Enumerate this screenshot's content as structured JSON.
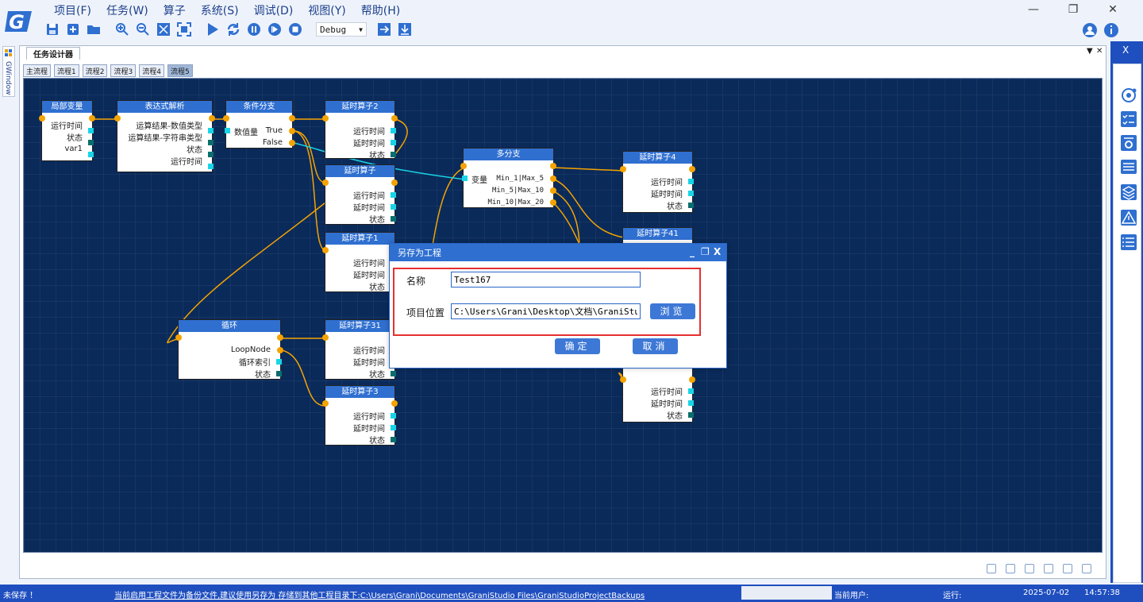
{
  "app": {
    "logo_letter": "G"
  },
  "menu": [
    "项目(F)",
    "任务(W)",
    "算子",
    "系统(S)",
    "调试(D)",
    "视图(Y)",
    "帮助(H)"
  ],
  "toolbar": {
    "mode_value": "Debug",
    "mode_arrow": "▼"
  },
  "window_controls": {
    "minimize": "—",
    "restore": "❐",
    "close": "✕"
  },
  "gwindow": {
    "label": "GWindow"
  },
  "designer": {
    "tab": "任务设计器",
    "controls": {
      "dropdown": "▼",
      "close": "✕"
    },
    "flow_tabs": [
      "主流程",
      "流程1",
      "流程2",
      "流程3",
      "流程4",
      "流程5"
    ],
    "active_flow_tab": 5
  },
  "nodes": {
    "local_var": {
      "title": "局部变量",
      "ports": [
        "运行时间",
        "状态",
        "var1"
      ]
    },
    "expr": {
      "title": "表达式解析",
      "ports": [
        "运算结果-数值类型",
        "运算结果-字符串类型",
        "状态",
        "运行时间"
      ]
    },
    "cond": {
      "title": "条件分支",
      "in_label": "数值量",
      "ports": [
        "True",
        "False"
      ]
    },
    "delay2": {
      "title": "延时算子2",
      "ports": [
        "运行时间",
        "延时时间",
        "状态"
      ]
    },
    "delay": {
      "title": "延时算子",
      "ports": [
        "运行时间",
        "延时时间",
        "状态"
      ]
    },
    "delay1": {
      "title": "延时算子1",
      "ports": [
        "运行时间",
        "延时时间",
        "状态"
      ]
    },
    "multi": {
      "title": "多分支",
      "in_label": "变量",
      "ports": [
        "Min_1|Max_5",
        "Min_5|Max_10",
        "Min_10|Max_20"
      ]
    },
    "delay4": {
      "title": "延时算子4",
      "ports": [
        "运行时间",
        "延时时间",
        "状态"
      ]
    },
    "delay41": {
      "title": "延时算子41",
      "ports": []
    },
    "loop": {
      "title": "循环",
      "ports": [
        "LoopNode",
        "循环索引",
        "状态"
      ]
    },
    "delay31": {
      "title": "延时算子31",
      "ports": [
        "运行时间",
        "延时时间",
        "状态"
      ]
    },
    "delay3": {
      "title": "延时算子3",
      "ports": [
        "运行时间",
        "延时时间",
        "状态"
      ]
    },
    "delay_hidden": {
      "ports": [
        "运行时间",
        "延时时间",
        "状态"
      ]
    }
  },
  "dialog": {
    "title": "另存为工程",
    "controls": {
      "minimize": "_",
      "restore": "❐",
      "close": "X"
    },
    "name_label": "名称",
    "name_value": "Test167",
    "location_label": "项目位置",
    "location_value": "C:\\Users\\Grani\\Desktop\\文档\\GraniStudio",
    "browse": "浏览",
    "ok": "确定",
    "cancel": "取消"
  },
  "status": {
    "unsaved": "未保存 ！",
    "notice": "当前启用工程文件为备份文件,建议使用另存为 存储到其他工程目录下:C:\\Users\\Grani\\Documents\\GraniStudio Files\\GraniStudioProjectBackups",
    "user_label": "当前用户:",
    "run_label": "运行:",
    "date": "2025-07-02",
    "time": "14:57:38"
  },
  "colors": {
    "accent": "#1f4fbf",
    "node_header": "#2f6fd0",
    "canvas": "#0a2a5a",
    "wire": "#f4a300",
    "wire_alt": "#19d4e6",
    "dialog_highlight": "#e53030"
  }
}
